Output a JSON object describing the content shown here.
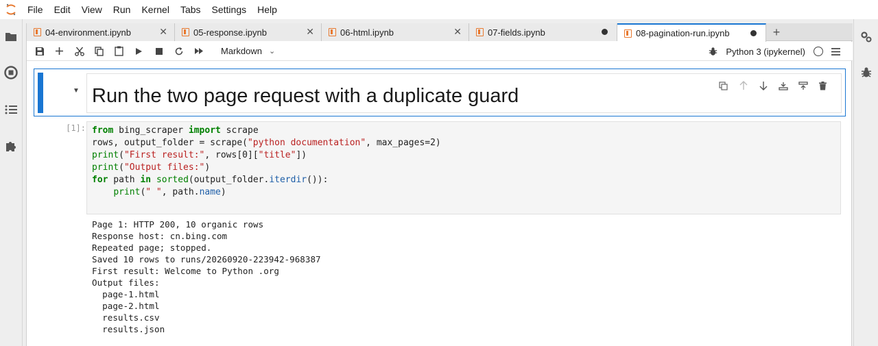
{
  "menu": [
    "File",
    "Edit",
    "View",
    "Run",
    "Kernel",
    "Tabs",
    "Settings",
    "Help"
  ],
  "tabs": [
    {
      "label": "04-environment.ipynb",
      "status": "close"
    },
    {
      "label": "05-response.ipynb",
      "status": "close"
    },
    {
      "label": "06-html.ipynb",
      "status": "close"
    },
    {
      "label": "07-fields.ipynb",
      "status": "dirty"
    },
    {
      "label": "08-pagination-run.ipynb",
      "status": "dirty",
      "active": true
    }
  ],
  "toolbar": {
    "cell_type": "Markdown",
    "kernel_name": "Python 3 (ipykernel)"
  },
  "markdown_cell": {
    "heading": "Run the two page request with a duplicate guard"
  },
  "code_cell": {
    "prompt": "[1]:",
    "lines": {
      "l1_kw": "from",
      "l1_mod": " bing_scraper ",
      "l1_kw2": "import",
      "l1_rest": " scrape",
      "l2_a": "rows, output_folder = scrape(",
      "l2_str": "\"python documentation\"",
      "l2_b": ", max_pages=2)",
      "l3_fn": "print",
      "l3_a": "(",
      "l3_str": "\"First result:\"",
      "l3_b": ", rows[0][",
      "l3_str2": "\"title\"",
      "l3_c": "])",
      "l4_fn": "print",
      "l4_a": "(",
      "l4_str": "\"Output files:\"",
      "l4_b": ")",
      "l5_kw": "for",
      "l5_a": " path ",
      "l5_kw2": "in",
      "l5_b": " ",
      "l5_fn": "sorted",
      "l5_c": "(output_folder.",
      "l5_attr": "iterdir",
      "l5_d": "()):",
      "l6_indent": "    ",
      "l6_fn": "print",
      "l6_a": "(",
      "l6_str": "\" \"",
      "l6_b": ", path.",
      "l6_attr": "name",
      "l6_c": ")"
    }
  },
  "output": [
    "Page 1: HTTP 200, 10 organic rows",
    "Response host: cn.bing.com",
    "Repeated page; stopped.",
    "Saved 10 rows to runs/20260920-223942-968387",
    "First result: Welcome to Python .org",
    "Output files:",
    "  page-1.html",
    "  page-2.html",
    "  results.csv",
    "  results.json"
  ]
}
